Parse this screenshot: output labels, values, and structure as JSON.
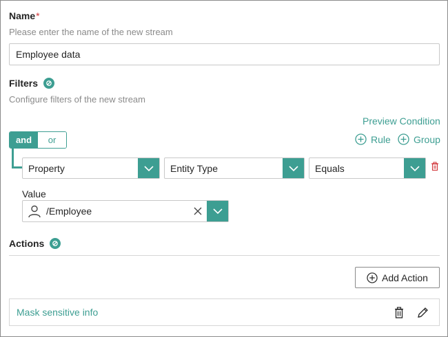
{
  "name_section": {
    "label": "Name",
    "required_mark": "*",
    "help": "Please enter the name of the new stream",
    "value": "Employee data"
  },
  "filters_section": {
    "label": "Filters",
    "help": "Configure filters of the new stream",
    "preview_condition": "Preview Condition",
    "add_rule": "Rule",
    "add_group": "Group",
    "logic_toggle": {
      "and": "and",
      "or": "or",
      "selected": "and"
    },
    "condition": {
      "field": "Property",
      "property": "Entity Type",
      "operator": "Equals",
      "value_label": "Value",
      "value": "/Employee"
    }
  },
  "actions_section": {
    "label": "Actions",
    "add_action": "Add Action",
    "items": [
      {
        "name": "Mask sensitive info"
      }
    ]
  },
  "colors": {
    "accent": "#3d9e92",
    "required": "#d13438",
    "delete": "#d13438"
  },
  "icons": [
    "info-icon",
    "plus-circle-icon",
    "chevron-down-icon",
    "delete-icon",
    "person-icon",
    "clear-icon",
    "trash-icon",
    "edit-icon"
  ]
}
